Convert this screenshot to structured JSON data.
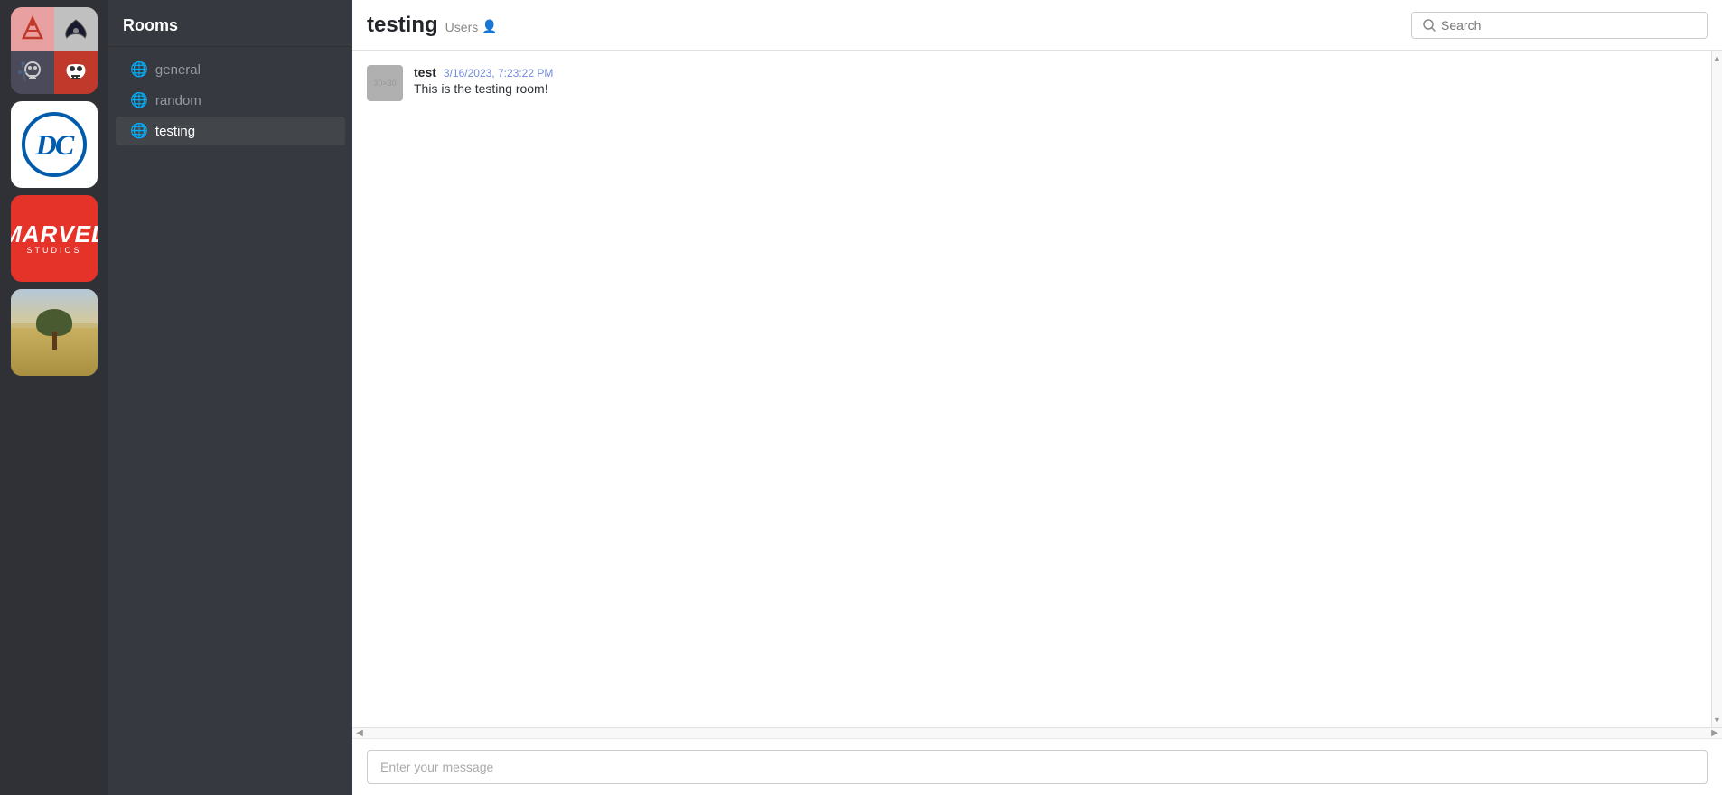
{
  "workspaces": [
    {
      "id": "anime",
      "label": "Anime Workspace"
    },
    {
      "id": "dc",
      "label": "DC Workspace"
    },
    {
      "id": "marvel",
      "label": "Marvel Studios Workspace"
    },
    {
      "id": "nature",
      "label": "Nature Workspace"
    }
  ],
  "sidebar": {
    "header": "Rooms",
    "rooms": [
      {
        "id": "general",
        "name": "general",
        "active": false
      },
      {
        "id": "random",
        "name": "random",
        "active": false
      },
      {
        "id": "testing",
        "name": "testing",
        "active": true
      }
    ]
  },
  "chat": {
    "title": "testing",
    "subtitle_label": "Users",
    "user_icon": "👤",
    "search_placeholder": "Search",
    "messages": [
      {
        "author": "test",
        "timestamp": "3/16/2023, 7:23:22 PM",
        "text": "This is the testing room!",
        "avatar_text": "30×30"
      }
    ],
    "message_input_placeholder": "Enter your message"
  },
  "dc_text": "DC",
  "marvel_text": "MARVEL",
  "marvel_studios_text": "STUDIOS"
}
